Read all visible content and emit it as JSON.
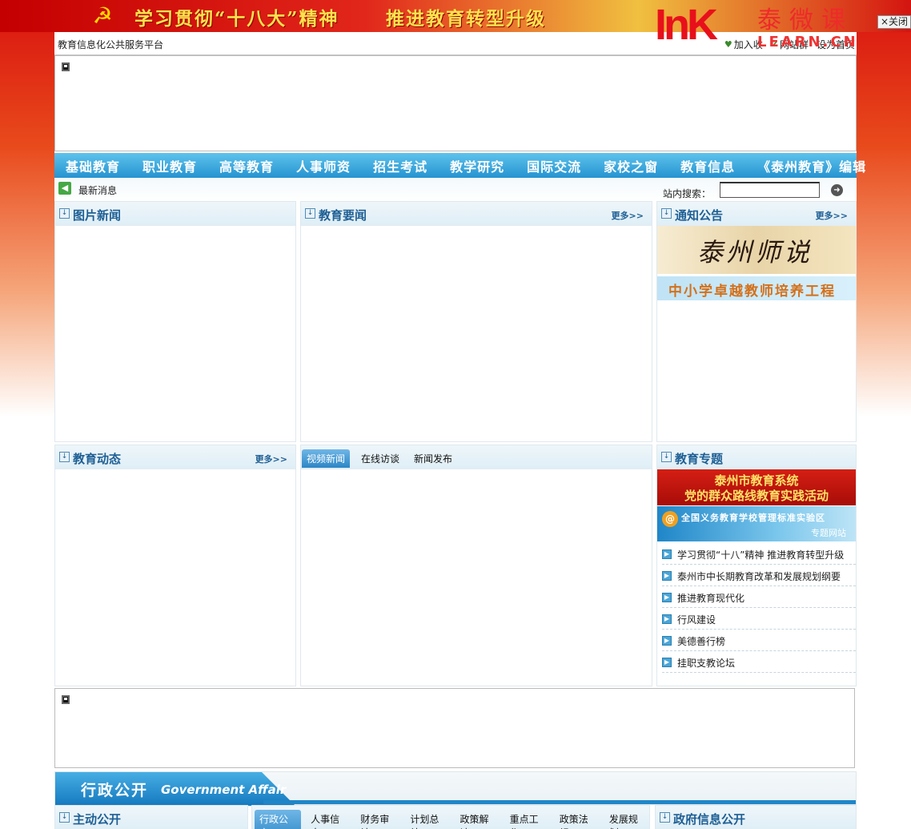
{
  "top_banner": {
    "emblem": "☭",
    "slogan_left": "学习贯彻“十八大”精神",
    "slogan_right": "推进教育转型升级",
    "close_label": "×关闭"
  },
  "watermark": {
    "logo": "InK",
    "name_cn": "泰微课",
    "name_en": "LEARN.CN"
  },
  "topbar": {
    "site_name": "教育信息化公共服务平台",
    "links": [
      "加入收",
      "网站群",
      "设为首页"
    ]
  },
  "nav": {
    "items": [
      "基础教育",
      "职业教育",
      "高等教育",
      "人事师资",
      "招生考试",
      "教学研究",
      "国际交流",
      "家校之窗",
      "教育信息",
      "《泰州教育》编辑"
    ]
  },
  "subbar": {
    "latest_label": "最新消息",
    "search_label": "站内搜索：",
    "search_value": ""
  },
  "panels": {
    "photo_news": {
      "title": "图片新闻"
    },
    "edu_news": {
      "title": "教育要闻",
      "more": "更多>>"
    },
    "notices": {
      "title": "通知公告",
      "more": "更多>>",
      "banner1": "泰州师说",
      "banner2": "中小学卓越教师培养工程"
    },
    "edu_dynamics": {
      "title": "教育动态",
      "more": "更多>>"
    },
    "video": {
      "tabs": [
        "视频新闻",
        "在线访谈",
        "新闻发布"
      ]
    },
    "topics": {
      "title": "教育专题",
      "party_line1": "泰州市教育系统",
      "party_line2": "党的群众路线教育实践活动",
      "junheng_logo": "@",
      "junheng_text": "全国义务教育学校管理标准实验区",
      "junheng_sub": "专题网站",
      "items": [
        "学习贯彻“十八”精神 推进教育转型升级",
        "泰州市中长期教育改革和发展规划纲要",
        "推进教育现代化",
        "行风建设",
        "美德善行榜",
        "挂职支教论坛"
      ]
    }
  },
  "gov": {
    "title_cn": "行政公开",
    "title_en": "Government Affair",
    "active_publish": "主动公开",
    "tabs": [
      "行政公文",
      "人事信息",
      "财务审计",
      "计划总结",
      "政策解读",
      "重点工作",
      "政策法规",
      "发展规划"
    ],
    "gov_info": "政府信息公开"
  }
}
